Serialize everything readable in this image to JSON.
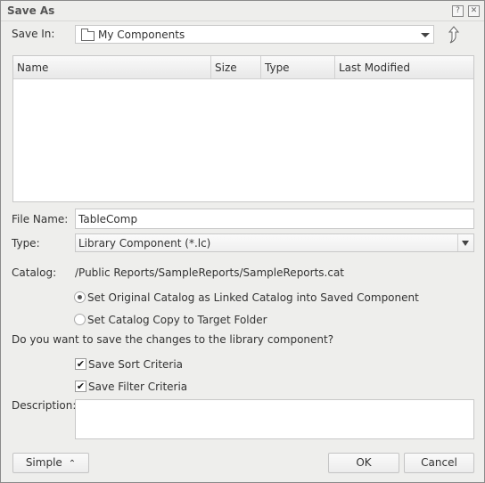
{
  "dialog": {
    "title": "Save As",
    "help_icon": "question-icon",
    "close_icon": "close-icon"
  },
  "save_in": {
    "label": "Save In:",
    "value": "My Components",
    "folder_icon": "folder-icon",
    "up_icon": "up-folder-icon"
  },
  "file_list": {
    "columns": [
      "Name",
      "Size",
      "Type",
      "Last Modified"
    ],
    "rows": []
  },
  "file_name": {
    "label": "File Name:",
    "value": "TableComp"
  },
  "type": {
    "label": "Type:",
    "value": "Library Component (*.lc)"
  },
  "catalog": {
    "label": "Catalog:",
    "value": "/Public Reports/SampleReports/SampleReports.cat",
    "options": [
      {
        "label": "Set Original Catalog as Linked Catalog into Saved Component",
        "checked": true
      },
      {
        "label": "Set Catalog Copy to Target Folder",
        "checked": false
      }
    ]
  },
  "changes": {
    "question": "Do you want to save the changes to the library component?",
    "options": [
      {
        "label": "Save Sort Criteria",
        "checked": true
      },
      {
        "label": "Save Filter Criteria",
        "checked": true
      }
    ]
  },
  "description": {
    "label": "Description:",
    "value": ""
  },
  "buttons": {
    "simple": "Simple",
    "simple_icon": "double-chevron-up-icon",
    "ok": "OK",
    "cancel": "Cancel"
  }
}
